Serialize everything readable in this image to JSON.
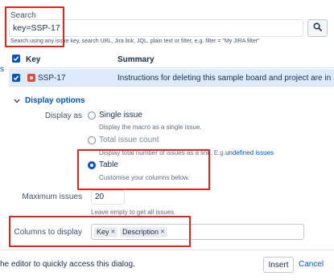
{
  "search": {
    "label": "Search",
    "value": "key=SSP-17",
    "help": "Search using any issue key, search URL, Jira link, JQL, plain text or filter, e.g. filter = \"My JIRA filter\""
  },
  "edge_link": "s",
  "table": {
    "headers": [
      "Key",
      "Summary"
    ],
    "rows": [
      {
        "key": "SSP-17",
        "summary": "Instructions for deleting this sample board and project are in ..."
      }
    ]
  },
  "display_options": {
    "title": "Display options",
    "display_as_label": "Display as",
    "options": [
      {
        "label": "Single issue",
        "description": "Display the macro as a single issue.",
        "selected": false
      },
      {
        "label": "Total issue count",
        "description": "Display total number of issues as a link. E.g.",
        "link": "undefined issues",
        "selected": false
      },
      {
        "label": "Table",
        "description": "Customise your columns below.",
        "selected": true
      }
    ],
    "max_issues_label": "Maximum issues",
    "max_issues_value": "20",
    "max_issues_hint": "Leave empty to get all issues.",
    "columns_label": "Columns to display",
    "columns": [
      "Key",
      "Description"
    ]
  },
  "footer": {
    "hint": "he editor to quickly access this dialog.",
    "insert_label": "Insert",
    "cancel_label": "Cancel"
  },
  "colors": {
    "accent": "#0052cc",
    "annotation": "#e0231d",
    "selected_row": "#deebff"
  }
}
